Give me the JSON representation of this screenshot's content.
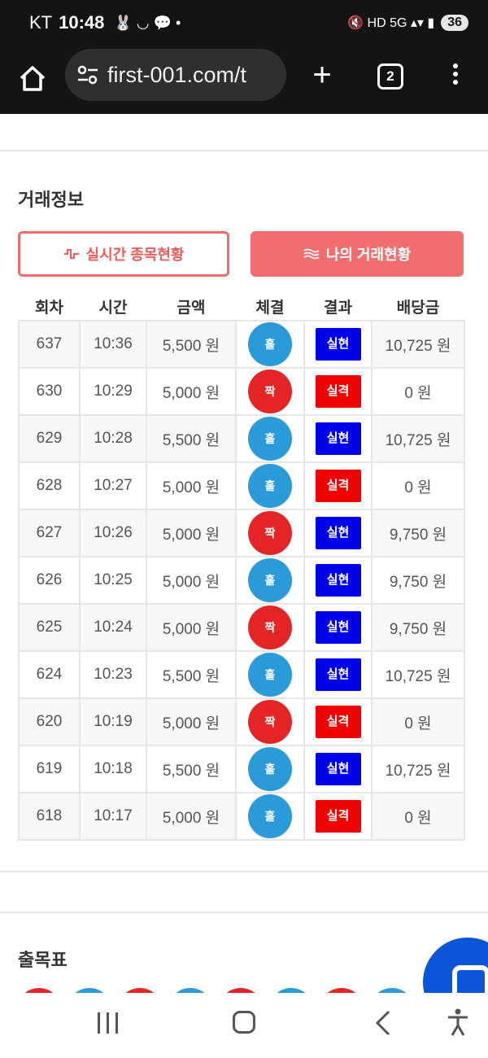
{
  "status_bar": {
    "carrier": "KT",
    "time": "10:48",
    "notifications": "🐰 ◡ 💬 •",
    "indicators": "🔇 HD 5G ▴▾ ▮",
    "battery": "36"
  },
  "browser": {
    "url": "first-001.com/t",
    "plus_label": "+",
    "tab_count": "2"
  },
  "section_trade": {
    "title": "거래정보",
    "live_button": "실시간 종목현황",
    "mine_button": "나의 거래현황"
  },
  "table": {
    "columns": [
      "회차",
      "시간",
      "금액",
      "체결",
      "결과",
      "배당금"
    ],
    "rows": [
      {
        "round": "637",
        "time": "10:36",
        "amount": "5,500 원",
        "fill": "홀",
        "result": "실현",
        "payout": "10,725 원"
      },
      {
        "round": "630",
        "time": "10:29",
        "amount": "5,000 원",
        "fill": "짝",
        "result": "실격",
        "payout": "0 원"
      },
      {
        "round": "629",
        "time": "10:28",
        "amount": "5,500 원",
        "fill": "홀",
        "result": "실현",
        "payout": "10,725 원"
      },
      {
        "round": "628",
        "time": "10:27",
        "amount": "5,000 원",
        "fill": "홀",
        "result": "실격",
        "payout": "0 원"
      },
      {
        "round": "627",
        "time": "10:26",
        "amount": "5,000 원",
        "fill": "짝",
        "result": "실현",
        "payout": "9,750 원"
      },
      {
        "round": "626",
        "time": "10:25",
        "amount": "5,000 원",
        "fill": "홀",
        "result": "실현",
        "payout": "9,750 원"
      },
      {
        "round": "625",
        "time": "10:24",
        "amount": "5,000 원",
        "fill": "짝",
        "result": "실현",
        "payout": "9,750 원"
      },
      {
        "round": "624",
        "time": "10:23",
        "amount": "5,500 원",
        "fill": "홀",
        "result": "실현",
        "payout": "10,725 원"
      },
      {
        "round": "620",
        "time": "10:19",
        "amount": "5,000 원",
        "fill": "짝",
        "result": "실격",
        "payout": "0 원"
      },
      {
        "round": "619",
        "time": "10:18",
        "amount": "5,500 원",
        "fill": "홀",
        "result": "실현",
        "payout": "10,725 원"
      },
      {
        "round": "618",
        "time": "10:17",
        "amount": "5,000 원",
        "fill": "홀",
        "result": "실격",
        "payout": "0 원"
      }
    ]
  },
  "section_chart": {
    "title": "출목표"
  },
  "colors": {
    "odd": "#2b9ad9",
    "even": "#e52525",
    "win": "#0000ee",
    "lose": "#f20000",
    "accent": "#f26d6d"
  },
  "labels": {
    "odd": "홀",
    "even": "짝",
    "win": "실현",
    "lose": "실격"
  },
  "bead_colors": [
    "#e52525",
    "#2b9ad9",
    "#e52525",
    "#2b9ad9",
    "#e52525",
    "#2b9ad9",
    "#e52525",
    "#2b9ad9"
  ]
}
